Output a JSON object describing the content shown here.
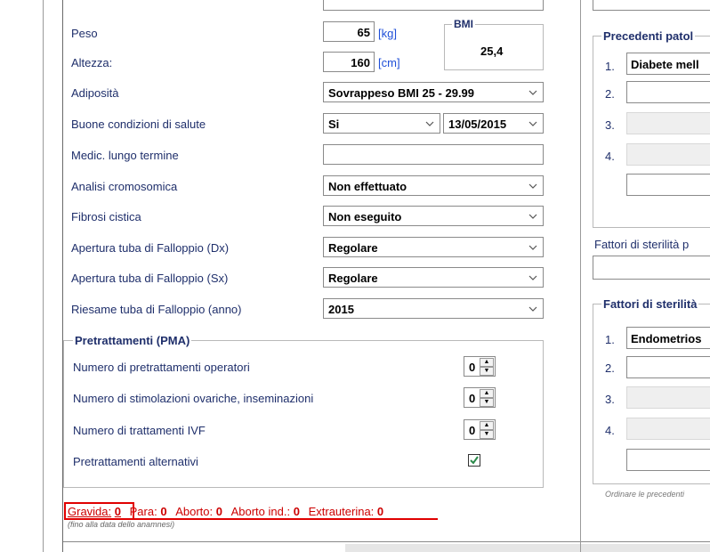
{
  "left_panel": {
    "peso": {
      "label": "Peso",
      "value": "65",
      "unit": "[kg]"
    },
    "altezza": {
      "label": "Altezza:",
      "value": "160",
      "unit": "[cm]"
    },
    "bmi": {
      "label": "BMI",
      "value": "25,4"
    },
    "adiposita": {
      "label": "Adiposità",
      "value": "Sovrappeso BMI 25 - 29.99"
    },
    "buone_condizioni": {
      "label": "Buone condizioni di salute",
      "value": "Si",
      "date": "13/05/2015"
    },
    "medic": {
      "label": "Medic. lungo termine",
      "value": ""
    },
    "analisi": {
      "label": "Analisi cromosomica",
      "value": "Non effettuato"
    },
    "fibrosi": {
      "label": "Fibrosi cistica",
      "value": "Non eseguito"
    },
    "tuba_dx": {
      "label": "Apertura tuba di Falloppio (Dx)",
      "value": "Regolare"
    },
    "tuba_sx": {
      "label": "Apertura tuba di Falloppio (Sx)",
      "value": "Regolare"
    },
    "riesame": {
      "label": "Riesame tuba di Falloppio (anno)",
      "value": "2015"
    }
  },
  "pretrattamenti": {
    "title": "Pretrattamenti (PMA)",
    "rows": [
      {
        "label": "Numero di pretrattamenti operatori",
        "value": "0"
      },
      {
        "label": "Numero di stimolazioni ovariche, inseminazioni",
        "value": "0"
      },
      {
        "label": "Numero di trattamenti IVF",
        "value": "0"
      }
    ],
    "alternativi": {
      "label": "Pretrattamenti alternativi",
      "checked": true
    }
  },
  "footer": {
    "gravida_label": "Gravida:",
    "gravida_value": "0",
    "para_label": "Para:",
    "para_value": "0",
    "aborto_label": "Aborto:",
    "aborto_value": "0",
    "aborto_ind_label": "Aborto ind.:",
    "aborto_ind_value": "0",
    "extra_label": "Extrauterina:",
    "extra_value": "0",
    "note": "(fino alla data dello anamnesi)"
  },
  "right_panel": {
    "precedenti_title": "Precedenti patol",
    "precedenti": [
      {
        "num": "1.",
        "value": "Diabete mell"
      },
      {
        "num": "2.",
        "value": ""
      },
      {
        "num": "3.",
        "value": ""
      },
      {
        "num": "4.",
        "value": ""
      }
    ],
    "fattori_p_label": "Fattori di sterilità p",
    "fattori_title": "Fattori di sterilità",
    "fattori": [
      {
        "num": "1.",
        "value": "Endometrios"
      },
      {
        "num": "2.",
        "value": ""
      },
      {
        "num": "3.",
        "value": ""
      },
      {
        "num": "4.",
        "value": ""
      }
    ],
    "ordinare_note": "Ordinare le precedenti"
  }
}
